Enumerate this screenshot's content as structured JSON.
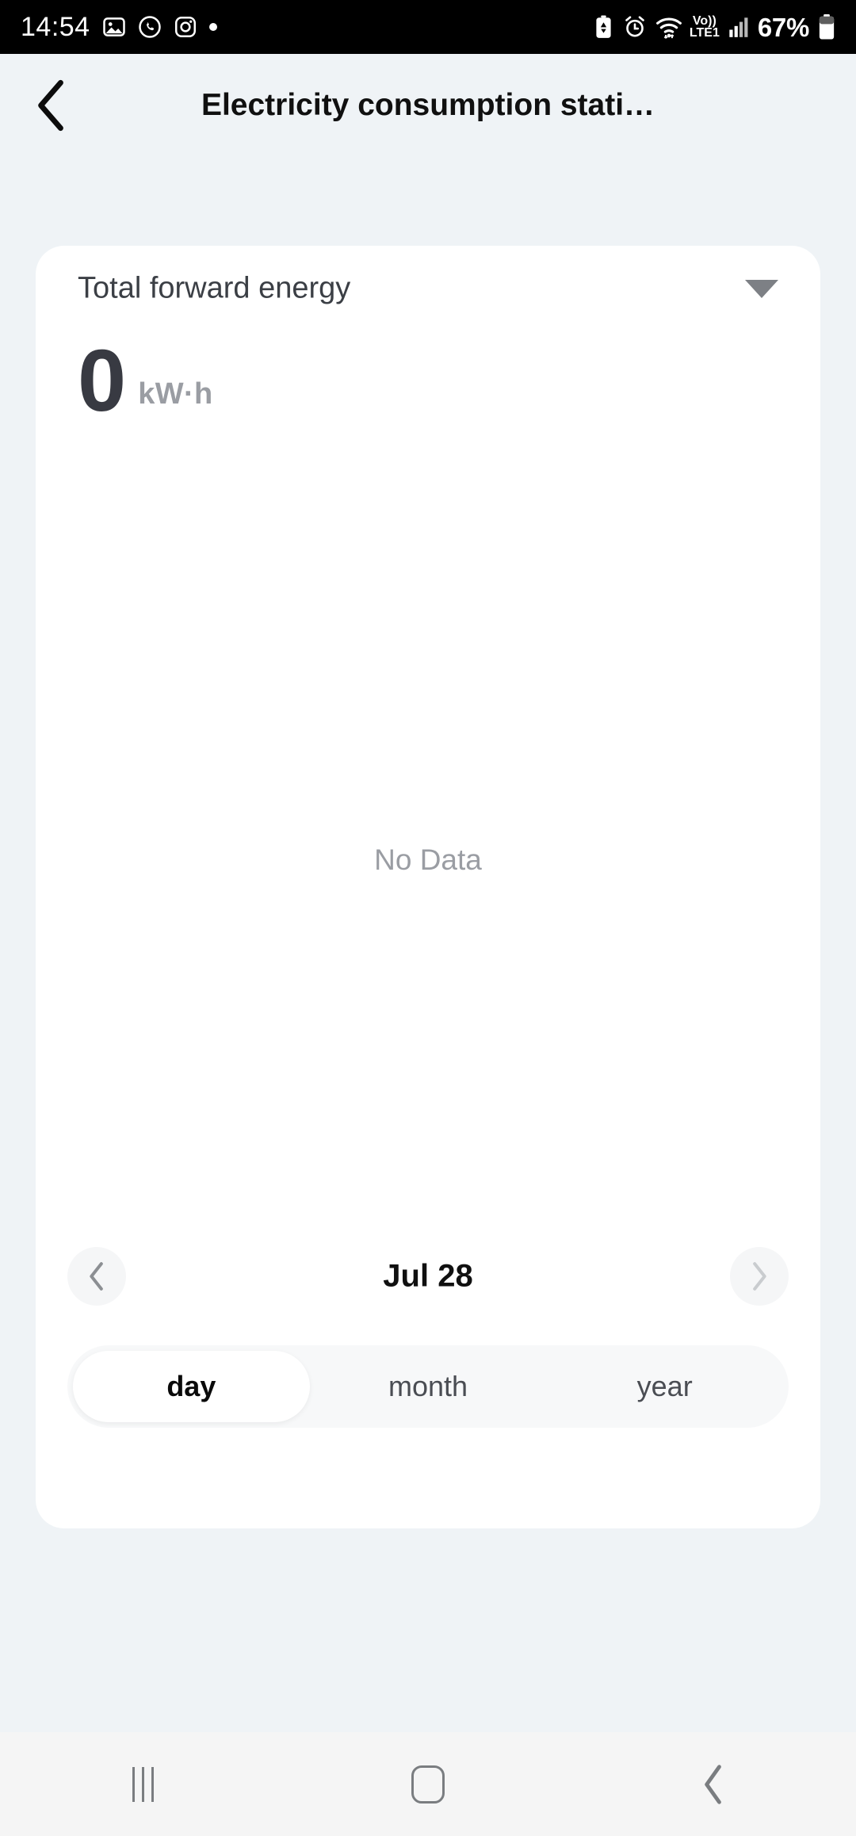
{
  "status_bar": {
    "time": "14:54",
    "battery_percent": "67%",
    "network_label_top": "Vo))",
    "network_label_bottom": "LTE1",
    "left_icons": [
      "gallery-icon",
      "whatsapp-icon",
      "instagram-icon",
      "dot-indicator-icon"
    ],
    "right_icons": [
      "battery-saver-icon",
      "alarm-icon",
      "wifi-icon",
      "volte-icon",
      "signal-icon",
      "battery-icon"
    ]
  },
  "app_bar": {
    "back_label": "back-chevron",
    "title": "Electricity consumption stati…"
  },
  "card": {
    "metric_label": "Total forward energy",
    "dropdown_icon": "chevron-down-icon",
    "total_value": "0",
    "total_unit": "kW·h",
    "chart_empty_text": "No Data",
    "date": {
      "prev_icon": "chevron-left-icon",
      "current": "Jul 28",
      "next_icon": "chevron-right-icon"
    },
    "range_tabs": [
      {
        "label": "day",
        "selected": true
      },
      {
        "label": "month",
        "selected": false
      },
      {
        "label": "year",
        "selected": false
      }
    ]
  },
  "nav_bar": {
    "recents_label": "recents-button",
    "home_label": "home-button",
    "back_label": "back-button"
  },
  "chart_data": {
    "type": "bar",
    "title": "Total forward energy",
    "categories": [],
    "values": [],
    "xlabel": "",
    "ylabel": "kW·h",
    "empty_state": "No Data",
    "total": 0,
    "unit": "kW·h",
    "period": "Jul 28",
    "granularity": "day"
  },
  "colors": {
    "page_background": "#EFF3F6",
    "card_background": "#FFFFFF",
    "status_bar_background": "#000000",
    "nav_bar_background": "#F5F5F5",
    "value_text": "#383A42",
    "muted_text": "#9A9DA3",
    "segment_track": "#F7F8F9"
  }
}
